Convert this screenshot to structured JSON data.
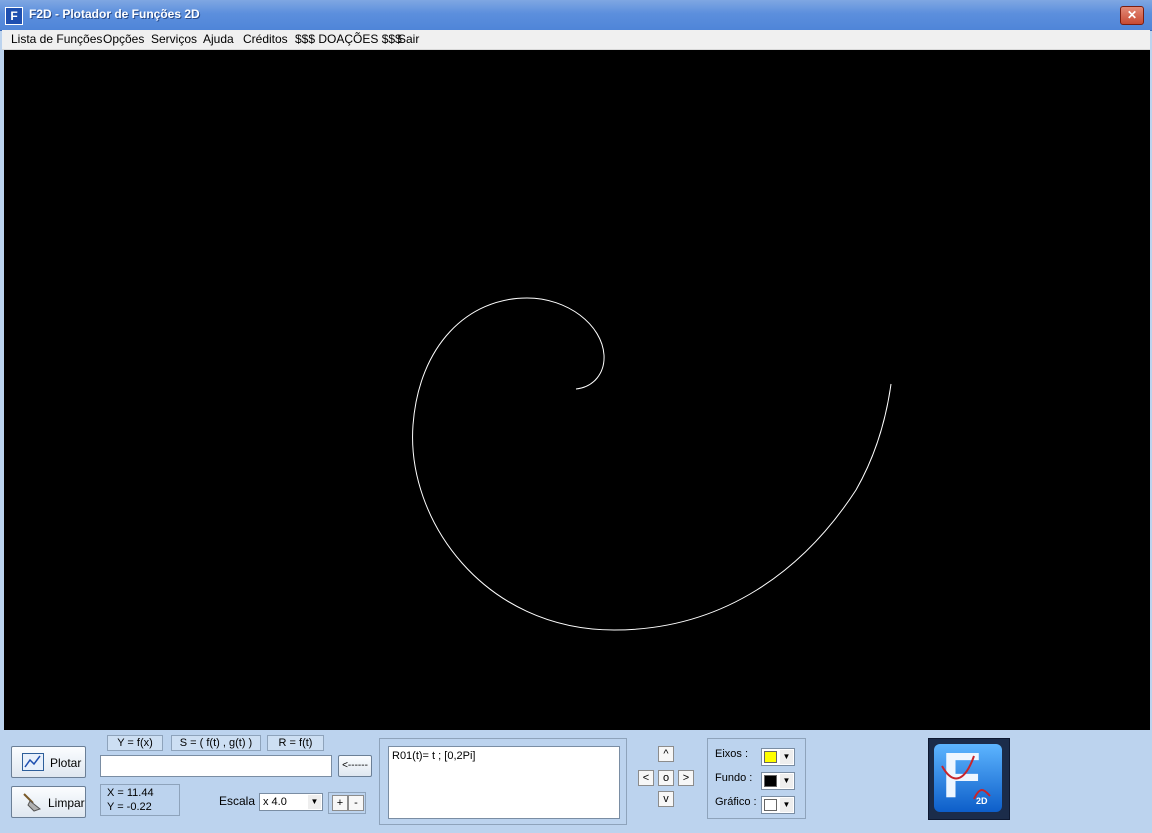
{
  "window": {
    "title": "F2D  -  Plotador de Funções 2D",
    "icon": "F",
    "close": "✕"
  },
  "menu": [
    {
      "label": "Lista de Funções"
    },
    {
      "label": "Opções"
    },
    {
      "label": "Serviços"
    },
    {
      "label": "Ajuda"
    },
    {
      "label": "Créditos"
    },
    {
      "label": "$$$ DOAÇÕES $$$"
    },
    {
      "label": "Sair"
    }
  ],
  "plot": {
    "background": "#000000",
    "curve_color": "#ffffff",
    "function": "R01(t)= t ; [0,2Pi]"
  },
  "controls": {
    "plot_label": "Plotar",
    "clear_label": "Limpar",
    "mode_tabs": [
      "Y = f(x)",
      "S = ( f(t) , g(t) )",
      "R = f(t)"
    ],
    "function_input": "",
    "insert_label": "<------",
    "coords": {
      "x": "X =   11.44",
      "y": "Y =   -0.22"
    },
    "scale_label": "Escala :",
    "scale_value": "x 4.0",
    "zoom_in": "+",
    "zoom_out": "-"
  },
  "function_list": [
    "R01(t)= t ; [0,2Pi]"
  ],
  "nav": {
    "up": "^",
    "down": "v",
    "left": "<",
    "right": ">",
    "center": "o"
  },
  "colors": [
    {
      "label": "Eixos    :",
      "color": "#ffff00"
    },
    {
      "label": "Fundo  :",
      "color": "#000000"
    },
    {
      "label": "Gráfico :",
      "color": "#ffffff"
    }
  ],
  "logo": {
    "letter": "F",
    "badge": "2D"
  }
}
